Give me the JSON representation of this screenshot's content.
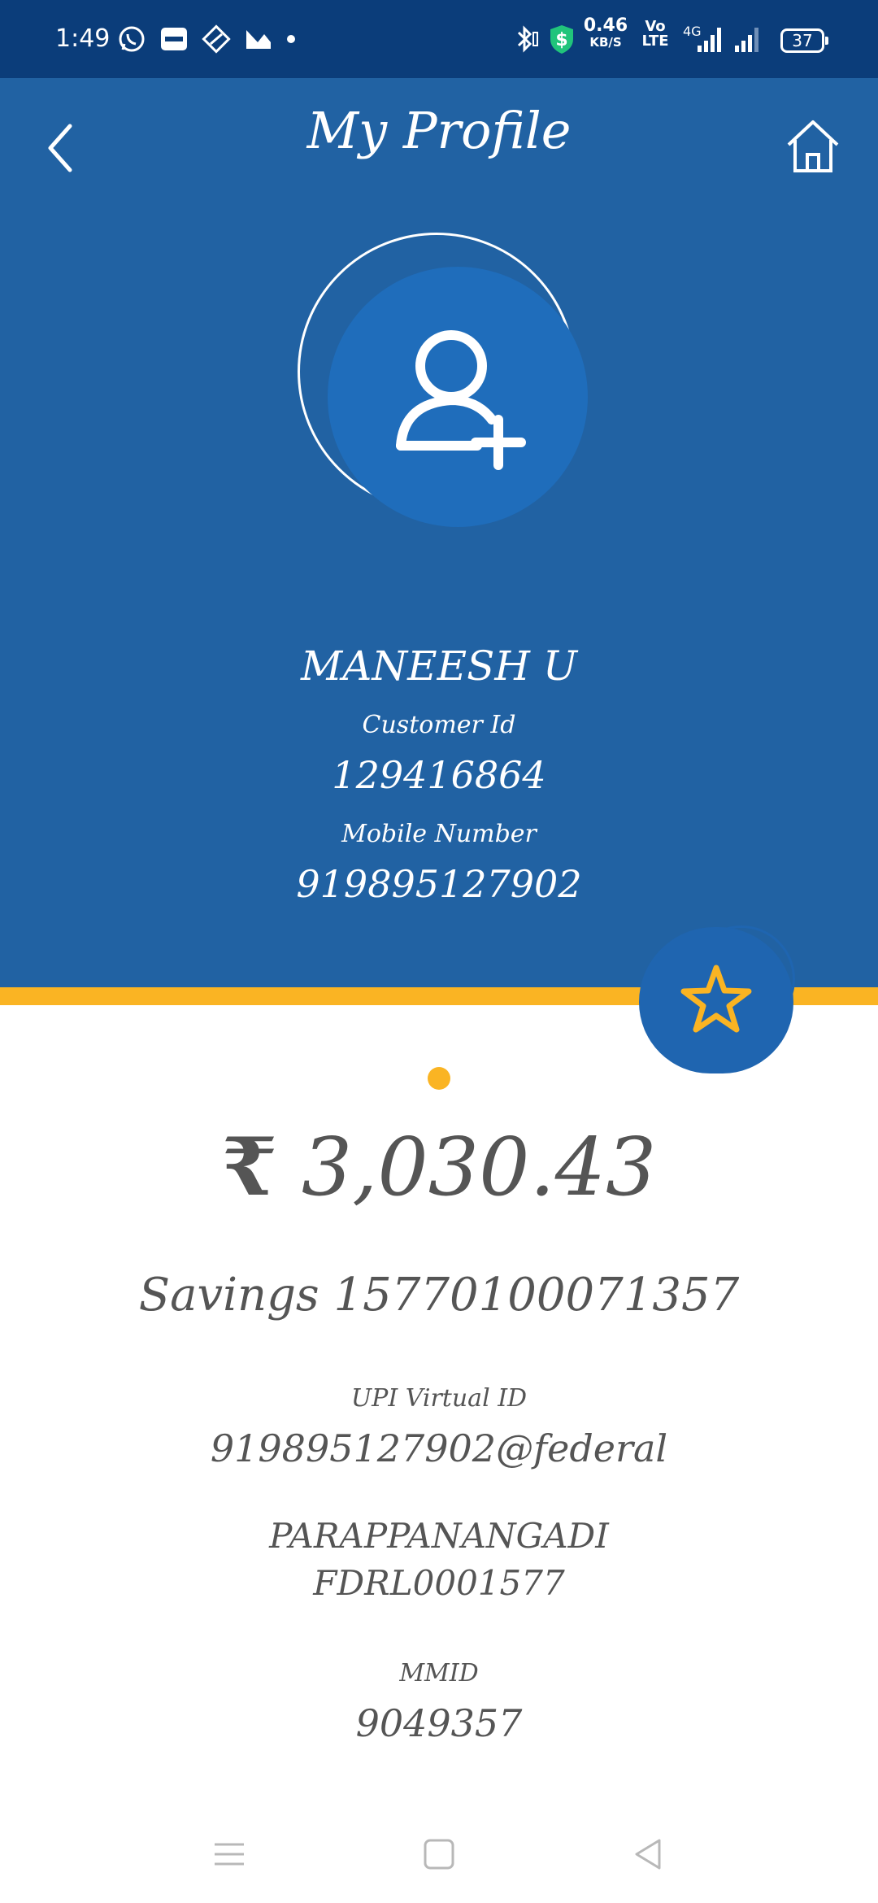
{
  "status_bar": {
    "time": "1:49",
    "net_speed": "0.46",
    "net_speed_unit": "KB/S",
    "volte_top": "Vo",
    "volte_bottom": "LTE",
    "network_type": "4G",
    "battery": "37",
    "notification_icons": [
      "whatsapp-icon",
      "paytm-icon",
      "app-icon",
      "gallery-icon",
      "dot-icon"
    ],
    "system_icons": [
      "bluetooth-icon",
      "vpn-icon",
      "signal-icon",
      "signal-icon"
    ]
  },
  "header": {
    "title": "My Profile",
    "back_icon": "chevron-left-icon",
    "home_icon": "home-icon"
  },
  "profile": {
    "avatar_icon": "add-user-icon",
    "name": "MANEESH U",
    "customer_id_label": "Customer Id",
    "customer_id": "129416864",
    "mobile_label": "Mobile Number",
    "mobile": "919895127902"
  },
  "favorite": {
    "icon": "star-icon"
  },
  "account": {
    "currency_symbol": "₹",
    "balance": "3,030.43",
    "account_line": "Savings 15770100071357",
    "upi_label": "UPI Virtual ID",
    "upi_id": "919895127902@federal",
    "branch": "PARAPPANANGADI",
    "ifsc": "FDRL0001577",
    "mmid_label": "MMID",
    "mmid": "9049357"
  },
  "colors": {
    "status_bar": "#0b3d7a",
    "header_blue": "#2162a3",
    "avatar_blue": "#1f6dbb",
    "accent_yellow": "#fab423",
    "text_gray": "#555555"
  },
  "nav": {
    "icons": [
      "menu-icon",
      "home-square-icon",
      "back-triangle-icon"
    ]
  }
}
